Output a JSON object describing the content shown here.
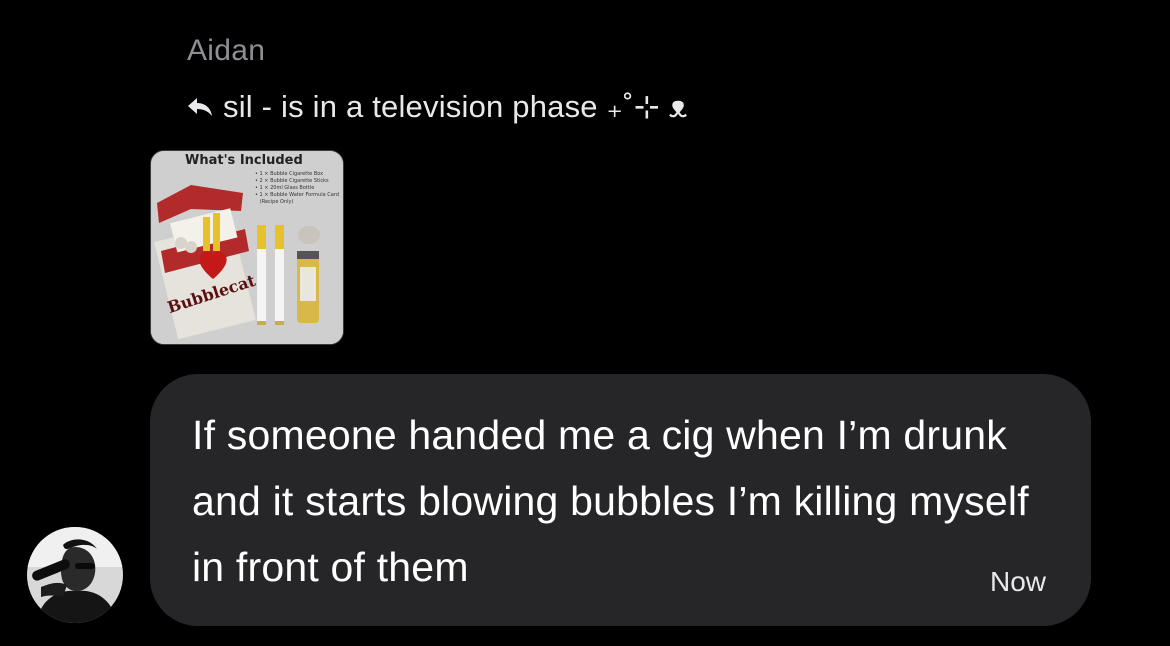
{
  "message": {
    "sender_name": "Aidan",
    "reply_to": "sil - is in a television phase ₊˚⊹ ᴥ",
    "text": "If someone handed me a cig when I’m drunk and it starts blowing bubbles I’m killing myself in front of them",
    "timestamp": "Now"
  },
  "attachment": {
    "title": "What's Included",
    "items": "• 1 × Bubble Cigarette Box\n• 2 × Bubble Cigarette Sticks\n• 1 × 20ml Glass Bottle\n• 1 × Bubble Water Formula Card\n   (Recipe Only)",
    "brand": "Bubblecat"
  },
  "icons": {
    "reply": "reply-arrow-icon",
    "avatar": "avatar"
  },
  "colors": {
    "background": "#000000",
    "bubble": "#262628",
    "sender_text": "#8e8e93",
    "message_text": "#ffffff"
  }
}
